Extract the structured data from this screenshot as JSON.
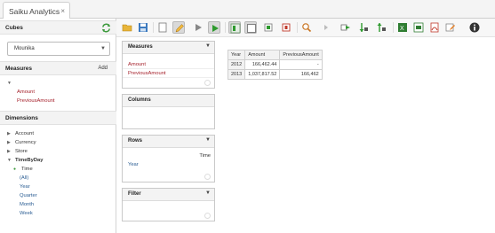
{
  "tab": {
    "title": "Saiku Analytics",
    "close": "×"
  },
  "sidebar": {
    "cubes_title": "Cubes",
    "cube_selected": "Mounika",
    "measures_title": "Measures",
    "add_label": "Add",
    "measures": [
      "Amount",
      "PreviousAmount"
    ],
    "dimensions_title": "Dimensions",
    "dimensions": [
      "Account",
      "Currency",
      "Store",
      "TimeByDay"
    ],
    "time_hierarchy": "Time",
    "time_levels": [
      "(All)",
      "Year",
      "Quarter",
      "Month",
      "Week"
    ]
  },
  "toolbar": {
    "icons": [
      "open-query-icon",
      "save-icon",
      "new-query-icon",
      "edit-icon",
      "run-icon",
      "automatic-execution-icon",
      "toggle-fields-icon",
      "hide-parents-icon",
      "non-empty-icon",
      "swap-axis-icon",
      "zoom-icon",
      "drillthrough-icon",
      "export-icon",
      "sort-asc-icon",
      "sort-desc-icon",
      "export-xls-icon",
      "export-csv-icon",
      "export-pdf-icon",
      "edit-mdx-icon",
      "info-icon"
    ]
  },
  "workspace": {
    "measures_panel": {
      "title": "Measures",
      "items": [
        "Amount",
        "PreviousAmount"
      ]
    },
    "columns_panel": {
      "title": "Columns"
    },
    "rows_panel": {
      "title": "Rows",
      "hierarchy": "Time",
      "items": [
        "Year"
      ]
    },
    "filter_panel": {
      "title": "Filter"
    }
  },
  "result_table": {
    "headers": [
      "Year",
      "Amount",
      "PreviousAmount"
    ],
    "rows": [
      [
        "2012",
        "166,462.44",
        "-"
      ],
      [
        "2013",
        "1,037,817.52",
        "166,462"
      ]
    ]
  },
  "colors": {
    "measure_red": "#a6232d",
    "level_blue": "#2a5d93",
    "run_green": "#2e9a2e"
  }
}
